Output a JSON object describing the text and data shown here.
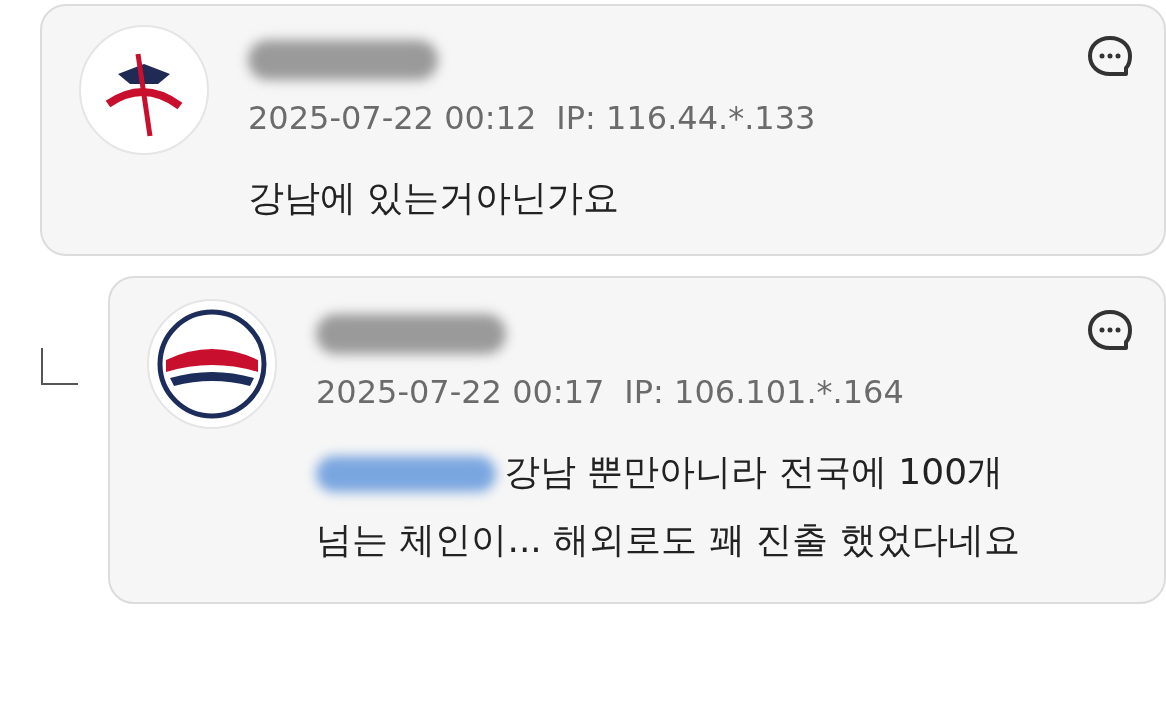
{
  "comments": [
    {
      "kind": "comment",
      "date": "2025-07-22 00:12",
      "ip": "IP: 116.44.*.133",
      "text": "강남에 있는거아닌가요",
      "mention_hidden": false
    },
    {
      "kind": "reply",
      "date": "2025-07-22 00:17",
      "ip": "IP: 106.101.*.164",
      "text": "강남 뿐만아니라 전국에 100개 넘는 체인이... 해외로도 꽤 진출 했었다네요",
      "mention_hidden": true
    }
  ]
}
